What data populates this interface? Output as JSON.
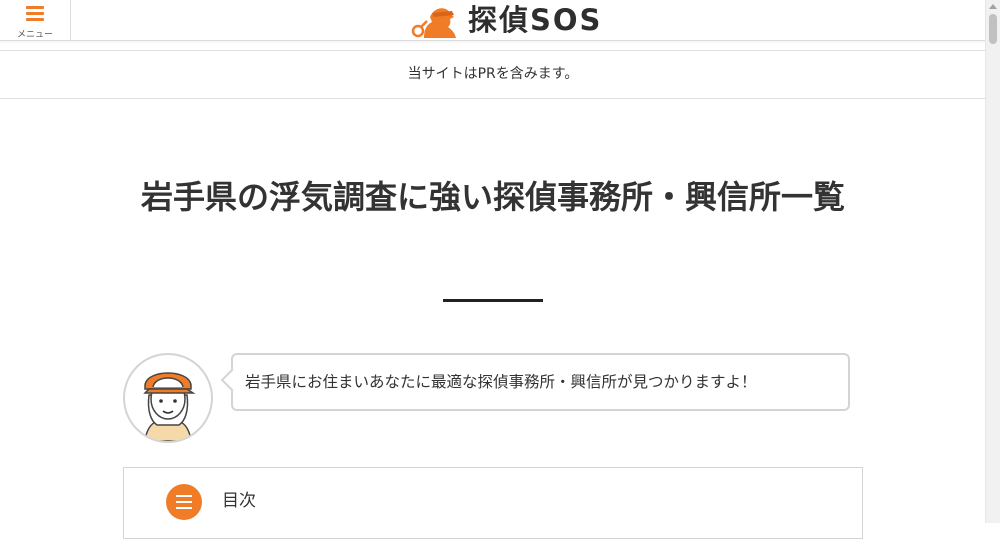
{
  "header": {
    "menu_label": "メニュー",
    "menu_icon": "hamburger-menu-icon",
    "logo_text": "探偵SOS",
    "logo_icon": "detective-silhouette-icon",
    "accent_color": "#f07c28"
  },
  "notice": {
    "text": "当サイトはPRを含みます。"
  },
  "main": {
    "title": "岩手県の浮気調査に強い探偵事務所・興信所一覧"
  },
  "speech": {
    "avatar_icon": "detective-girl-avatar",
    "text": "岩手県にお住まいあなたに最適な探偵事務所・興信所が見つかりますよ！"
  },
  "toc": {
    "icon": "list-icon",
    "label": "目次"
  }
}
